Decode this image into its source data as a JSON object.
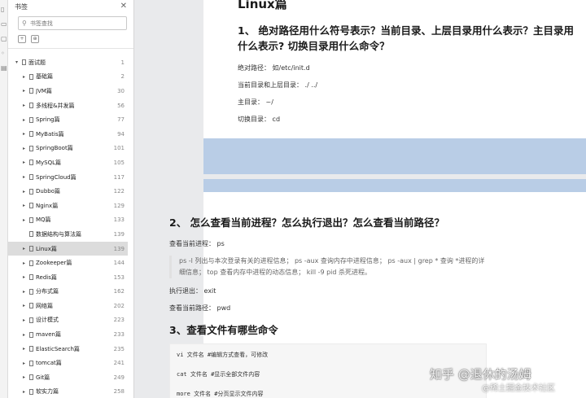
{
  "sidebar": {
    "title": "书签",
    "search_placeholder": "书签查找",
    "items": [
      {
        "label": "面试题",
        "page": "1",
        "root": true
      },
      {
        "label": "基础篇",
        "page": "2"
      },
      {
        "label": "JVM篇",
        "page": "30"
      },
      {
        "label": "多线程&并发篇",
        "page": "56"
      },
      {
        "label": "Spring篇",
        "page": "77"
      },
      {
        "label": "MyBatis篇",
        "page": "94"
      },
      {
        "label": "SpringBoot篇",
        "page": "101"
      },
      {
        "label": "MySQL篇",
        "page": "105"
      },
      {
        "label": "SpringCloud篇",
        "page": "117"
      },
      {
        "label": "Dubbo篇",
        "page": "122"
      },
      {
        "label": "Nginx篇",
        "page": "129"
      },
      {
        "label": "MQ篇",
        "page": "133"
      },
      {
        "label": "数据结构与算法篇",
        "page": "139",
        "leaf": true
      },
      {
        "label": "Linux篇",
        "page": "139",
        "selected": true
      },
      {
        "label": "Zookeeper篇",
        "page": "144"
      },
      {
        "label": "Redis篇",
        "page": "153"
      },
      {
        "label": "分布式篇",
        "page": "162"
      },
      {
        "label": "网络篇",
        "page": "202"
      },
      {
        "label": "设计模式",
        "page": "223"
      },
      {
        "label": "maven篇",
        "page": "233"
      },
      {
        "label": "ElasticSearch篇",
        "page": "235"
      },
      {
        "label": "tomcat篇",
        "page": "241"
      },
      {
        "label": "Git篇",
        "page": "249"
      },
      {
        "label": "软实力篇",
        "page": "258"
      }
    ]
  },
  "doc": {
    "title": "Linux篇",
    "q1": "1、 绝对路径用什么符号表示？当前目录、上层目录用什么表示？主目录用什么表示? 切换目录用什么命令？",
    "a1_1": "绝对路径： 如/etc/init.d",
    "a1_2": "当前目录和上层目录： ./ ../",
    "a1_3": "主目录： ~/",
    "a1_4": "切换目录： cd",
    "q2": "2、 怎么查看当前进程？怎么执行退出？怎么查看当前路径？",
    "a2_1": "查看当前进程： ps",
    "a2_quote": "ps -l 列出与本次登录有关的进程信息； ps -aux 查询内存中进程信息； ps -aux | grep * 查询 *进程的详细信息； top 查看内存中进程的动态信息； kill -9 pid 杀死进程。",
    "a2_2": "执行退出： exit",
    "a2_3": "查看当前路径： pwd",
    "q3": "3、查看文件有哪些命令",
    "code": [
      "vi 文件名 #编辑方式查看，可修改",
      "cat 文件名 #显示全部文件内容",
      "more 文件名 #分页显示文件内容"
    ]
  },
  "watermark": {
    "main": "知乎 @退休的汤姆",
    "sub": "@稀土掘金技术社区"
  }
}
